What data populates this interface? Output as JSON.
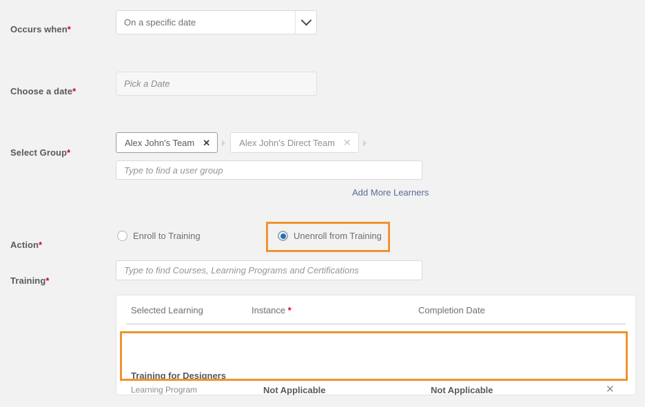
{
  "colors": {
    "page_background": "#f2f2f2",
    "highlight_orange": "#f0932b",
    "required_red": "#d0021b",
    "link_blue": "#5a6a94",
    "radio_selected_blue": "#1d73c4"
  },
  "form": {
    "occurs_when": {
      "label": "Occurs when",
      "required_marker": "*",
      "selected_value": "On a specific date"
    },
    "choose_date": {
      "label": "Choose a date",
      "required_marker": "*",
      "value": "",
      "placeholder": "Pick a Date"
    },
    "select_group": {
      "label": "Select Group",
      "required_marker": "*",
      "chips": [
        {
          "label": "Alex John's Team",
          "remove_icon": "✕"
        },
        {
          "label": "Alex John's Direct Team",
          "remove_icon": "✕"
        }
      ],
      "input_placeholder": "Type to find a user group",
      "input_value": "",
      "add_more_link": "Add More Learners"
    },
    "action": {
      "label": "Action",
      "required_marker": "*",
      "options": [
        {
          "label": "Enroll to Training",
          "selected": false
        },
        {
          "label": "Unenroll from Training",
          "selected": true
        }
      ]
    },
    "training": {
      "label": "Training",
      "required_marker": "*",
      "input_placeholder": "Type to find Courses, Learning Programs and Certifications",
      "input_value": ""
    }
  },
  "table": {
    "headers": {
      "selected_learning": "Selected Learning",
      "instance": "Instance",
      "instance_required_marker": "*",
      "completion_date": "Completion Date"
    },
    "rows": [
      {
        "title": "Training for Designers",
        "subtitle": "Learning Program",
        "instance": "Not Applicable",
        "completion_date": "Not Applicable",
        "remove_icon": "✕"
      }
    ]
  }
}
